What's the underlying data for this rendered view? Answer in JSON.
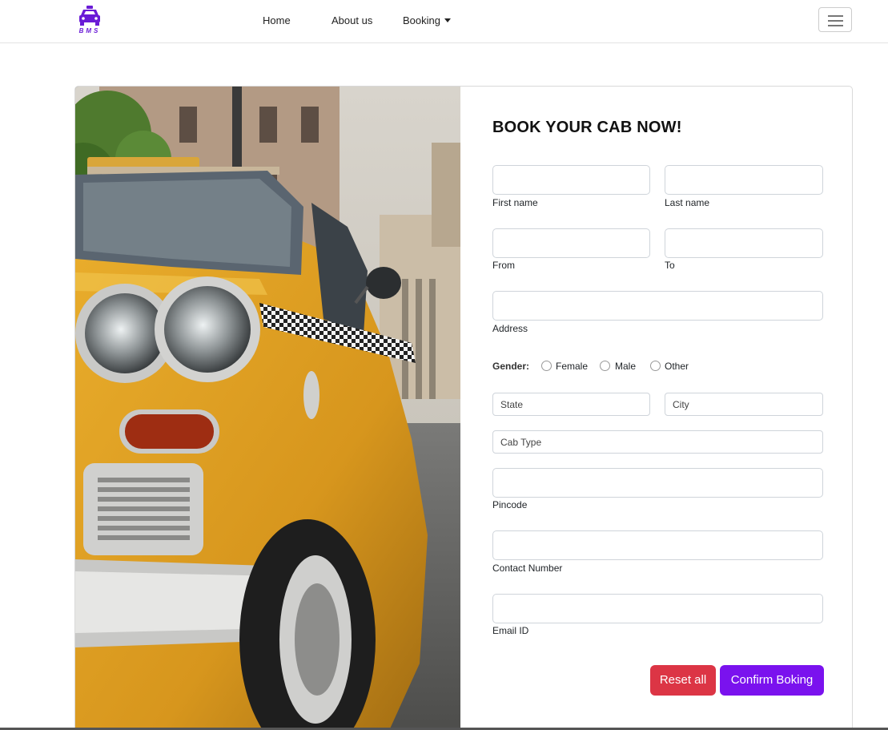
{
  "brand": {
    "logo_text": "BMS"
  },
  "nav": {
    "home": "Home",
    "about": "About us",
    "booking": "Booking"
  },
  "form": {
    "title": "BOOK YOUR CAB NOW!",
    "first_name_label": "First name",
    "last_name_label": "Last name",
    "from_label": "From",
    "to_label": "To",
    "address_label": "Address",
    "gender_label": "Gender:",
    "gender_options": [
      "Female",
      "Male",
      "Other"
    ],
    "state_value": "State",
    "city_value": "City",
    "cab_type_value": "Cab Type",
    "pincode_label": "Pincode",
    "contact_label": "Contact Number",
    "email_label": "Email ID",
    "reset_label": "Reset all",
    "confirm_label": "Confirm Boking"
  },
  "colors": {
    "brand": "#6a1bd6",
    "reset": "#dc3545",
    "confirm": "#7a12ee"
  },
  "icons": {
    "logo": "taxi-icon",
    "menu": "hamburger-menu-icon",
    "booking": "caret-down-icon"
  }
}
